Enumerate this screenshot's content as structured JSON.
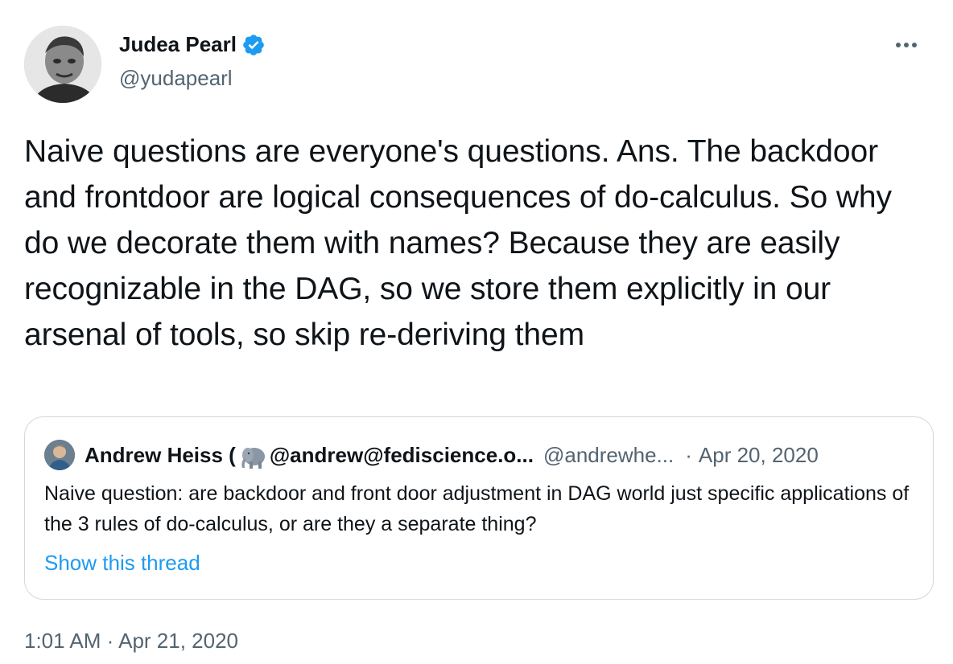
{
  "author": {
    "name": "Judea Pearl",
    "handle": "@yudapearl",
    "avatar_icon": "person-photo",
    "verified_icon": "verified-badge-icon"
  },
  "tweet": {
    "text": "Naive questions are everyone's questions. Ans. The backdoor and frontdoor are logical consequences of do-calculus. So why do we decorate them with names? Because they are easily recognizable in the DAG, so we store them explicitly in our arsenal of tools, so skip re-deriving them",
    "time": "1:01 AM",
    "separator": "·",
    "date": "Apr 21, 2020"
  },
  "quoted": {
    "name_prefix": "Andrew Heiss (",
    "name_suffix": "@andrew@fediscience.o...",
    "handle": "@andrewhe...",
    "separator": "·",
    "date": "Apr 20, 2020",
    "text": "Naive question: are backdoor and front door adjustment in DAG world just specific applications of the 3 rules of do-calculus, or are they a separate thing?",
    "show_thread": "Show this thread",
    "emoji_icon": "elephant-icon"
  },
  "colors": {
    "primary_text": "#0f1419",
    "secondary_text": "#536471",
    "link": "#1d9bf0",
    "border": "#cfd9de",
    "verified": "#1d9bf0"
  }
}
